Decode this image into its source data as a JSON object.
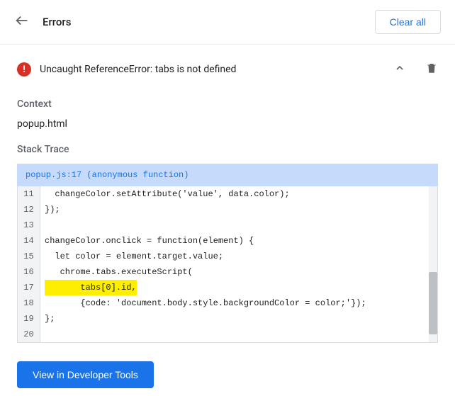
{
  "header": {
    "title": "Errors",
    "clear_all_label": "Clear all"
  },
  "error": {
    "message": "Uncaught ReferenceError: tabs is not defined",
    "badge": "!"
  },
  "sections": {
    "context_label": "Context",
    "context_value": "popup.html",
    "stack_trace_label": "Stack Trace",
    "stack_trace_header": "popup.js:17 (anonymous function)"
  },
  "code": {
    "lines": [
      {
        "num": "11",
        "text": "  changeColor.setAttribute('value', data.color);",
        "highlight": false
      },
      {
        "num": "12",
        "text": "});",
        "highlight": false
      },
      {
        "num": "13",
        "text": "",
        "highlight": false
      },
      {
        "num": "14",
        "text": "changeColor.onclick = function(element) {",
        "highlight": false
      },
      {
        "num": "15",
        "text": "  let color = element.target.value;",
        "highlight": false
      },
      {
        "num": "16",
        "text": "   chrome.tabs.executeScript(",
        "highlight": false
      },
      {
        "num": "17",
        "text": "       tabs[0].id,",
        "highlight": true
      },
      {
        "num": "18",
        "text": "       {code: 'document.body.style.backgroundColor = color;'});",
        "highlight": false
      },
      {
        "num": "19",
        "text": "};",
        "highlight": false
      },
      {
        "num": "20",
        "text": "",
        "highlight": false
      }
    ]
  },
  "footer": {
    "view_tools_label": "View in Developer Tools"
  }
}
